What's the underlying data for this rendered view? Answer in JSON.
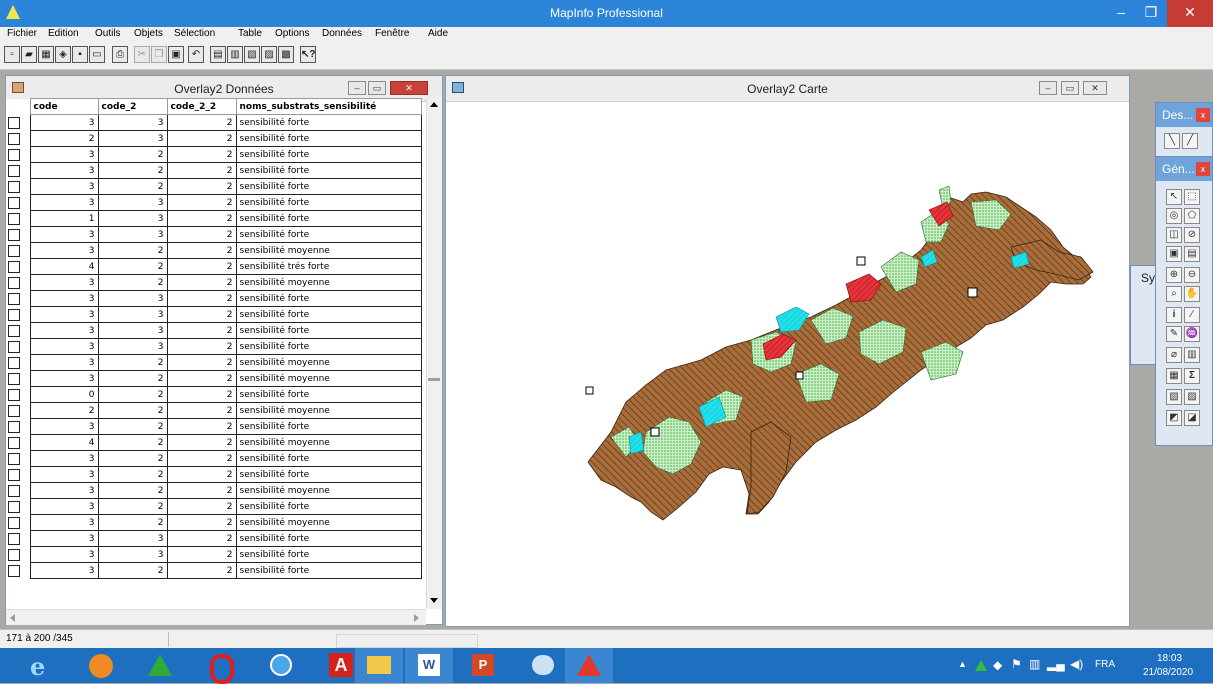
{
  "app": {
    "title": "MapInfo Professional"
  },
  "menu": [
    "Fichier",
    "Edition",
    "Outils",
    "Objets",
    "Sélection",
    "Table",
    "Options",
    "Données",
    "Fenêtre",
    "Aide"
  ],
  "browser": {
    "title": "Overlay2 Données",
    "columns": [
      "code",
      "code_2",
      "code_2_2",
      "noms_substrats_sensibilité"
    ],
    "rows": [
      [
        "3",
        "3",
        "2",
        "sensibilité  forte"
      ],
      [
        "2",
        "3",
        "2",
        "sensibilité  forte"
      ],
      [
        "3",
        "2",
        "2",
        "sensibilité  forte"
      ],
      [
        "3",
        "2",
        "2",
        "sensibilité  forte"
      ],
      [
        "3",
        "2",
        "2",
        "sensibilité  forte"
      ],
      [
        "3",
        "3",
        "2",
        "sensibilité  forte"
      ],
      [
        "1",
        "3",
        "2",
        "sensibilité  forte"
      ],
      [
        "3",
        "3",
        "2",
        "sensibilité  forte"
      ],
      [
        "3",
        "2",
        "2",
        "sensibilité moyenne"
      ],
      [
        "4",
        "2",
        "2",
        "sensibilité trés forte"
      ],
      [
        "3",
        "2",
        "2",
        "sensibilité moyenne"
      ],
      [
        "3",
        "3",
        "2",
        "sensibilité  forte"
      ],
      [
        "3",
        "3",
        "2",
        "sensibilité  forte"
      ],
      [
        "3",
        "3",
        "2",
        "sensibilité  forte"
      ],
      [
        "3",
        "3",
        "2",
        "sensibilité  forte"
      ],
      [
        "3",
        "2",
        "2",
        "sensibilité moyenne"
      ],
      [
        "3",
        "2",
        "2",
        "sensibilité moyenne"
      ],
      [
        "0",
        "2",
        "2",
        "sensibilité  forte"
      ],
      [
        "2",
        "2",
        "2",
        "sensibilité moyenne"
      ],
      [
        "3",
        "2",
        "2",
        "sensibilité  forte"
      ],
      [
        "4",
        "2",
        "2",
        "sensibilité moyenne"
      ],
      [
        "3",
        "2",
        "2",
        "sensibilité  forte"
      ],
      [
        "3",
        "2",
        "2",
        "sensibilité  forte"
      ],
      [
        "3",
        "2",
        "2",
        "sensibilité moyenne"
      ],
      [
        "3",
        "2",
        "2",
        "sensibilité  forte"
      ],
      [
        "3",
        "2",
        "2",
        "sensibilité moyenne"
      ],
      [
        "3",
        "3",
        "2",
        "sensibilité  forte"
      ],
      [
        "3",
        "3",
        "2",
        "sensibilité  forte"
      ],
      [
        "3",
        "2",
        "2",
        "sensibilité  forte"
      ]
    ]
  },
  "map": {
    "title": "Overlay2 Carte"
  },
  "palettes": {
    "drawing": "Des...",
    "general": "Gén...",
    "symbols": "Sy"
  },
  "status": {
    "record_range": "171 à 200 /345"
  },
  "taskbar": {
    "lang": "FRA",
    "time": "18:03",
    "date": "21/08/2020"
  }
}
